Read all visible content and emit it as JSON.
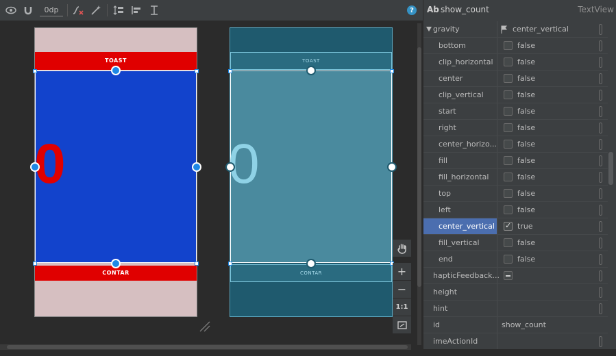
{
  "toolbar": {
    "margin_value": "0dp",
    "help_label": "?"
  },
  "design": {
    "toast_label": "TOAST",
    "count_value": "0",
    "contar_label": "CONTAR",
    "colors": {
      "background": "#d6bfc1",
      "button": "#e00000",
      "textview": "#1243cc"
    }
  },
  "blueprint": {
    "toast_label": "TOAST",
    "count_value": "0",
    "contar_label": "CONTAR"
  },
  "zoom_strip": {
    "zoom_in": "+",
    "zoom_out": "−",
    "actual_size": "1:1"
  },
  "attributes": {
    "icon_label": "Ab",
    "view_id": "show_count",
    "view_type": "TextView",
    "gravity": {
      "name": "gravity",
      "value": "center_vertical"
    },
    "gravity_flags": [
      {
        "name": "bottom",
        "value": "false",
        "checked": false
      },
      {
        "name": "clip_horizontal",
        "value": "false",
        "checked": false
      },
      {
        "name": "center",
        "value": "false",
        "checked": false
      },
      {
        "name": "clip_vertical",
        "value": "false",
        "checked": false
      },
      {
        "name": "start",
        "value": "false",
        "checked": false
      },
      {
        "name": "right",
        "value": "false",
        "checked": false
      },
      {
        "name": "center_horizo...",
        "value": "false",
        "checked": false
      },
      {
        "name": "fill",
        "value": "false",
        "checked": false
      },
      {
        "name": "fill_horizontal",
        "value": "false",
        "checked": false
      },
      {
        "name": "top",
        "value": "false",
        "checked": false
      },
      {
        "name": "left",
        "value": "false",
        "checked": false
      },
      {
        "name": "center_vertical",
        "value": "true",
        "checked": true
      },
      {
        "name": "fill_vertical",
        "value": "false",
        "checked": false
      },
      {
        "name": "end",
        "value": "false",
        "checked": false
      }
    ],
    "haptic": {
      "name": "hapticFeedback..."
    },
    "height": {
      "name": "height"
    },
    "hint": {
      "name": "hint"
    },
    "id": {
      "name": "id",
      "value": "show_count"
    },
    "ime": {
      "name": "imeActionId"
    }
  }
}
